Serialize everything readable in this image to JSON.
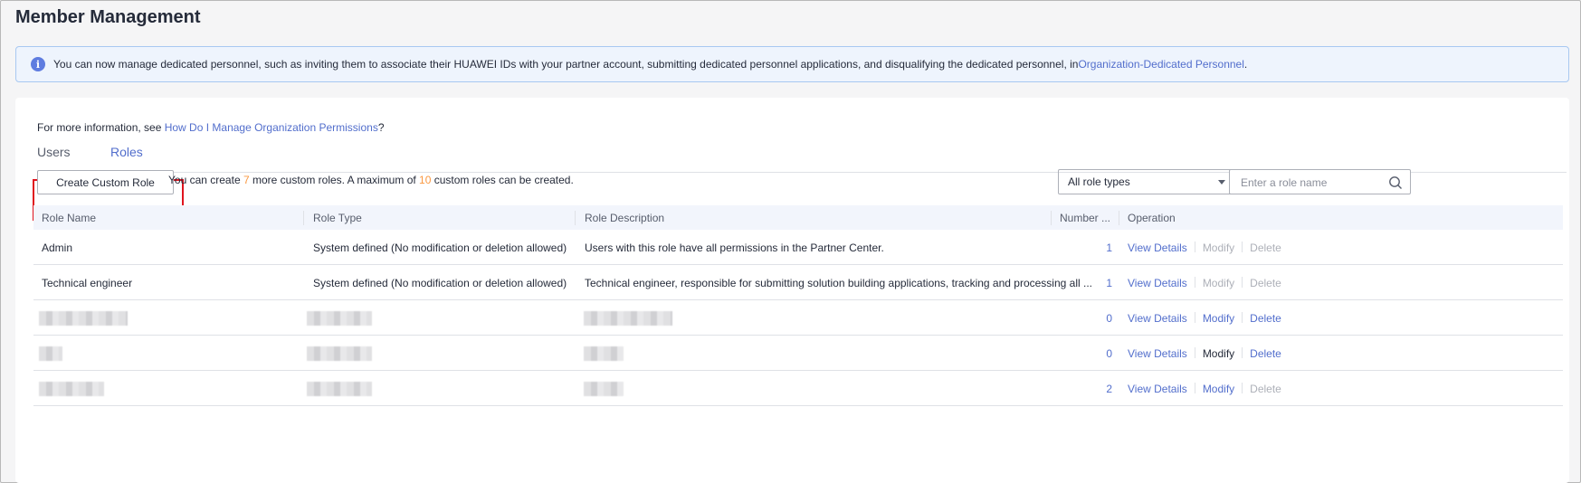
{
  "page": {
    "title": "Member Management"
  },
  "notice": {
    "text": "You can now manage dedicated personnel, such as inviting them to associate their HUAWEI IDs with your partner account, submitting dedicated personnel applications, and disqualifying the dedicated personnel, in ",
    "link": "Organization-Dedicated Personnel",
    "suffix": "."
  },
  "help": {
    "prefix": "For more information, see ",
    "link": "How Do I Manage Organization Permissions",
    "suffix": "?"
  },
  "tabs": [
    {
      "label": "Users",
      "active": false
    },
    {
      "label": "Roles",
      "active": true
    }
  ],
  "toolbar": {
    "create_label": "Create Custom Role",
    "quota_prefix": "You can create ",
    "remaining": "7",
    "quota_mid": " more custom roles. A maximum of ",
    "max": "10",
    "quota_suffix": " custom roles can be created.",
    "role_type_select": "All role types",
    "search_placeholder": "Enter a role name"
  },
  "table": {
    "headers": [
      "Role Name",
      "Role Type",
      "Role Description",
      "Number ...",
      "Operation"
    ],
    "rows": [
      {
        "name": "Admin",
        "type": "System defined (No modification or deletion allowed)",
        "description": "Users with this role have all permissions in the Partner Center.",
        "number": "1",
        "modify_enabled": false,
        "delete_enabled": false
      },
      {
        "name": "Technical engineer",
        "type": "System defined (No modification or deletion allowed)",
        "description": "Technical engineer, responsible for submitting solution building applications, tracking and processing all ...",
        "number": "1",
        "modify_enabled": false,
        "delete_enabled": false
      },
      {
        "name": "",
        "type": "",
        "description": "",
        "number": "0",
        "modify_enabled": true,
        "delete_enabled": true
      },
      {
        "name": "",
        "type": "",
        "description": "",
        "number": "0",
        "modify_enabled": true,
        "delete_enabled": true
      },
      {
        "name": "",
        "type": "",
        "description": "",
        "number": "2",
        "modify_enabled": true,
        "delete_enabled": false
      }
    ],
    "op_view": "View Details",
    "op_modify": "Modify",
    "op_delete": "Delete"
  },
  "colors": {
    "brand": "#526ecc",
    "highlight": "#e0141e",
    "accent": "#fa9841"
  }
}
